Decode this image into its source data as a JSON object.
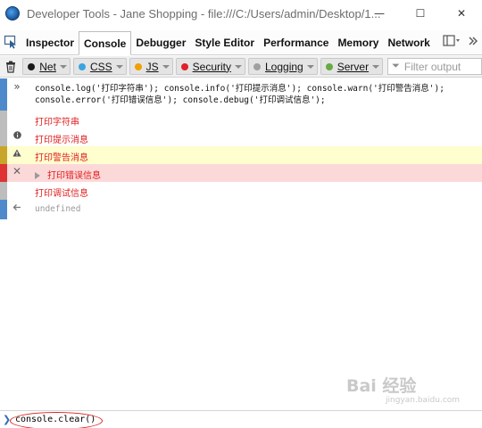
{
  "window": {
    "title": "Developer Tools - Jane Shopping - file:///C:/Users/admin/Desktop/1...",
    "minimize": "—",
    "maximize": "☐",
    "close": "✕"
  },
  "tabs": [
    {
      "label": "Inspector",
      "active": false
    },
    {
      "label": "Console",
      "active": true
    },
    {
      "label": "Debugger",
      "active": false
    },
    {
      "label": "Style Editor",
      "active": false
    },
    {
      "label": "Performance",
      "active": false
    },
    {
      "label": "Memory",
      "active": false
    },
    {
      "label": "Network",
      "active": false
    }
  ],
  "filters": [
    {
      "label": "Net",
      "color": "#1a1a1a"
    },
    {
      "label": "CSS",
      "color": "#3aa4e0"
    },
    {
      "label": "JS",
      "color": "#f0a000"
    },
    {
      "label": "Security",
      "color": "#e0202a"
    },
    {
      "label": "Logging",
      "color": "#a0a0a0"
    },
    {
      "label": "Server",
      "color": "#66aa44"
    }
  ],
  "filter_output": {
    "placeholder": "Filter output"
  },
  "console": {
    "input_line1": "console.log('打印字符串'); console.info('打印提示消息'); console.warn('打印警告消息');",
    "input_line2": "console.error('打印错误信息'); console.debug('打印调试信息');",
    "messages": [
      {
        "type": "log",
        "text": "打印字符串"
      },
      {
        "type": "info",
        "text": "打印提示消息"
      },
      {
        "type": "warn",
        "text": "打印警告消息"
      },
      {
        "type": "error",
        "text": "打印错误信息"
      },
      {
        "type": "debug",
        "text": "打印调试信息"
      }
    ],
    "result": "undefined"
  },
  "jsterm": {
    "value": "console.clear()"
  },
  "watermark": {
    "main": "Bai 经验",
    "sub": "jingyan.baidu.com"
  }
}
